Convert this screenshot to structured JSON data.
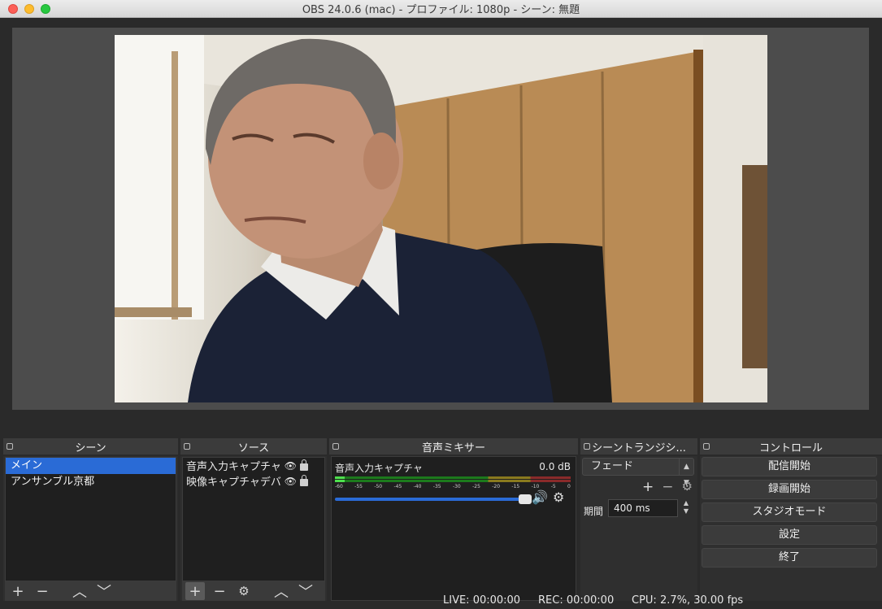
{
  "window": {
    "title": "OBS 24.0.6 (mac) - プロファイル: 1080p - シーン: 無題"
  },
  "scenes_dock": {
    "title": "シーン",
    "items": [
      {
        "label": "メイン",
        "selected": true
      },
      {
        "label": "アンサンブル京都",
        "selected": false
      }
    ]
  },
  "sources_dock": {
    "title": "ソース",
    "items": [
      {
        "label": "音声入力キャプチャ"
      },
      {
        "label": "映像キャプチャデバ"
      }
    ]
  },
  "mixer_dock": {
    "title": "音声ミキサー",
    "channel_name": "音声入力キャプチャ",
    "channel_db": "0.0 dB",
    "ticks": [
      "-60",
      "-55",
      "-50",
      "-45",
      "-40",
      "-35",
      "-30",
      "-25",
      "-20",
      "-15",
      "-10",
      "-5",
      "0"
    ]
  },
  "transitions_dock": {
    "title": "シーントランジシ...",
    "selected": "フェード",
    "duration_label": "期間",
    "duration_value": "400 ms"
  },
  "controls_dock": {
    "title": "コントロール",
    "buttons": [
      "配信開始",
      "録画開始",
      "スタジオモード",
      "設定",
      "終了"
    ]
  },
  "status": {
    "live": "LIVE: 00:00:00",
    "rec": "REC: 00:00:00",
    "cpu": "CPU: 2.7%, 30.00 fps"
  },
  "colors": {
    "accent": "#2a6bd6",
    "panel": "#2f2f2f"
  }
}
